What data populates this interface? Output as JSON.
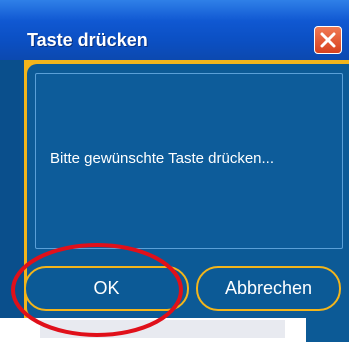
{
  "dialog": {
    "title": "Taste drücken",
    "message": "Bitte gewünschte Taste drücken...",
    "ok_label": "OK",
    "cancel_label": "Abbrechen"
  },
  "icons": {
    "close": "close-icon"
  },
  "colors": {
    "titlebar": "#1058d2",
    "body": "#0c5a96",
    "accent": "#f3b51b",
    "close": "#d8411f",
    "annotation": "#e0101a"
  }
}
